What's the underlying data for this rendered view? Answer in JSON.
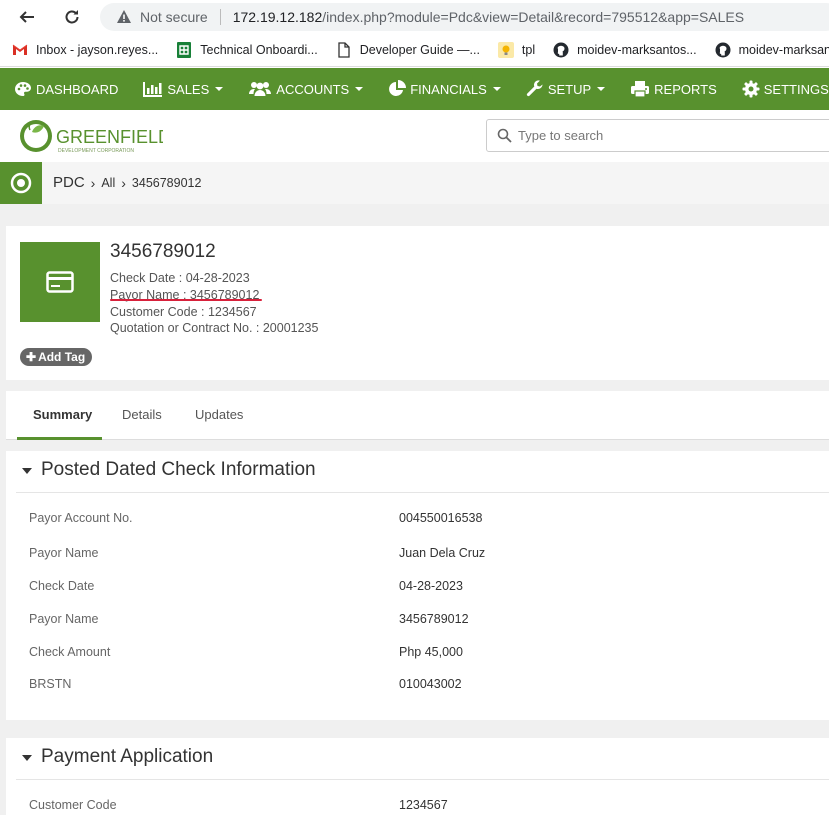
{
  "browser": {
    "not_secure": "Not secure",
    "url_host": "172.19.12.182",
    "url_path": "/index.php?module=Pdc&view=Detail&record=795512&app=SALES",
    "bookmarks": [
      {
        "label": "Inbox - jayson.reyes...",
        "icon": "gmail-icon"
      },
      {
        "label": "Technical Onboardi...",
        "icon": "sheets-icon"
      },
      {
        "label": "Developer Guide —...",
        "icon": "page-icon"
      },
      {
        "label": "tpl",
        "icon": "bulb-icon"
      },
      {
        "label": "moidev-marksantos...",
        "icon": "github-icon"
      },
      {
        "label": "moidev-marksantos...",
        "icon": "github-icon"
      }
    ]
  },
  "nav": {
    "items": [
      {
        "label": "DASHBOARD",
        "icon": "palette-icon",
        "caret": false
      },
      {
        "label": "SALES",
        "icon": "bar-chart-icon",
        "caret": true
      },
      {
        "label": "ACCOUNTS",
        "icon": "users-icon",
        "caret": true
      },
      {
        "label": "FINANCIALS",
        "icon": "pie-chart-icon",
        "caret": true
      },
      {
        "label": "SETUP",
        "icon": "wrench-icon",
        "caret": true
      },
      {
        "label": "REPORTS",
        "icon": "printer-icon",
        "caret": false
      },
      {
        "label": "SETTINGS",
        "icon": "gear-icon",
        "caret": true
      }
    ],
    "accent": "#58912e"
  },
  "header": {
    "logo_text": "GREENFIELD",
    "logo_sub": "DEVELOPMENT CORPORATION",
    "search_placeholder": "Type to search"
  },
  "breadcrumb": {
    "module": "PDC",
    "all": "All",
    "record": "3456789012"
  },
  "record": {
    "title": "3456789012",
    "check_date": "Check Date : 04-28-2023",
    "payor_name": "Payor Name : 3456789012",
    "customer_code": "Customer Code : 1234567",
    "quotation": "Quotation or Contract No. : 20001235",
    "add_tag": "Add Tag"
  },
  "tabs": [
    {
      "label": "Summary",
      "active": true
    },
    {
      "label": "Details",
      "active": false
    },
    {
      "label": "Updates",
      "active": false
    }
  ],
  "pdc_block": {
    "title": "Posted Dated Check Information",
    "fields": [
      {
        "label": "Payor Account No.",
        "value": "004550016538"
      },
      {
        "label": "Payor Name",
        "value": "Juan Dela Cruz"
      },
      {
        "label": "Check Date",
        "value": "04-28-2023"
      },
      {
        "label": "Payor Name",
        "value": "3456789012"
      },
      {
        "label": "Check Amount",
        "value": "Php 45,000"
      },
      {
        "label": "BRSTN",
        "value": "010043002"
      }
    ]
  },
  "payment_block": {
    "title": "Payment Application",
    "fields": [
      {
        "label": "Customer Code",
        "value": "1234567"
      }
    ]
  }
}
